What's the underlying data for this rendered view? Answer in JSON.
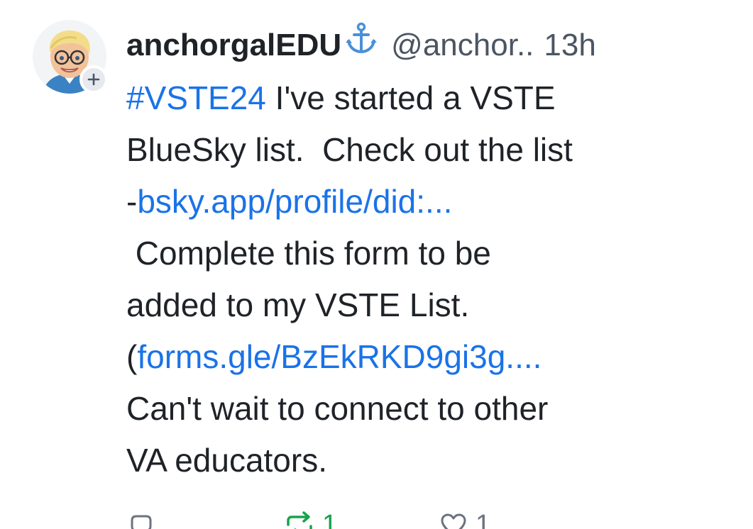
{
  "post": {
    "author": {
      "display_name": "anchorgalEDU",
      "handle": "@anchor..",
      "timestamp": "13h",
      "avatar_icon": "bitmoji-avatar-icon",
      "follow_icon": "plus-icon",
      "name_emoji_icon": "anchor-icon"
    },
    "body": {
      "line1_hashtag": "#VSTE24",
      "line1_text": " I've started a VSTE",
      "line2": "BlueSky list.  Check out the list",
      "line3_prefix": "-",
      "line3_link": "bsky.app/profile/did:...",
      "line4": " Complete this form to be",
      "line5": "added to my VSTE List.",
      "line6_prefix": "(",
      "line6_link": "forms.gle/BzEkRKD9gi3g....",
      "line7": "Can't wait to connect to other",
      "line8": "VA educators."
    },
    "actions": {
      "reply_icon": "reply-icon",
      "repost_icon": "repost-icon",
      "repost_count": "1",
      "like_icon": "heart-icon",
      "like_count": "1"
    },
    "colors": {
      "link": "#1a73e8",
      "text": "#1f2328",
      "muted": "#4b5563",
      "repost_active": "#16a34a",
      "anchor": "#4a90d9"
    }
  }
}
